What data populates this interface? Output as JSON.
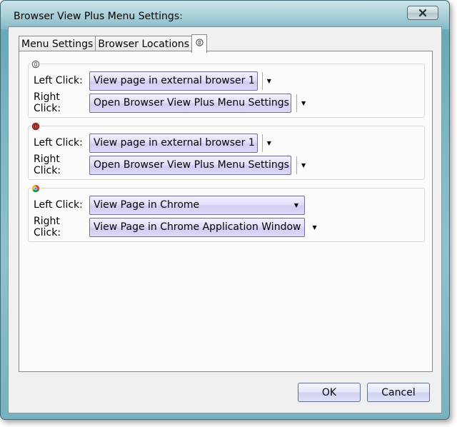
{
  "window": {
    "title": "Browser View Plus Menu Settings:",
    "close_icon": "close-icon"
  },
  "tabs": [
    {
      "label": "Menu Settings",
      "active": false
    },
    {
      "label": "Browser Locations",
      "active": false
    },
    {
      "label": "",
      "icon": "browser-view-plus-icon",
      "active": true
    }
  ],
  "groups": [
    {
      "icon": "browser-view-plus-icon",
      "left_label": "Left Click:",
      "left_value": "View page in external browser 1",
      "right_label": "Right Click:",
      "right_value": "Open Browser View Plus Menu Settings"
    },
    {
      "icon": "browser-view-plus-red-icon",
      "left_label": "Left Click:",
      "left_value": "View page in external browser 1",
      "right_label": "Right Click:",
      "right_value": "Open Browser View Plus Menu Settings"
    },
    {
      "icon": "chrome-icon",
      "left_label": "Left Click:",
      "left_value": "View Page in Chrome",
      "right_label": "Right Click:",
      "right_value": "View Page in Chrome Application Window"
    }
  ],
  "footer": {
    "ok_label": "OK",
    "cancel_label": "Cancel"
  },
  "colors": {
    "frame": "#7bb6c3",
    "dropdown": "#dcdaf7",
    "client": "#f0f0f0"
  }
}
